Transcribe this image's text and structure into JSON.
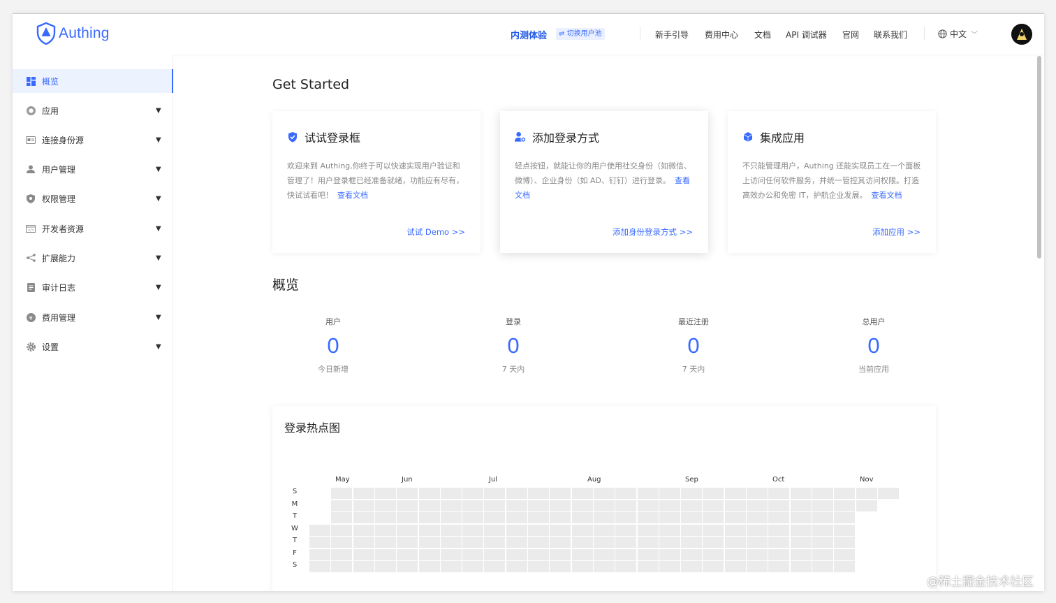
{
  "header": {
    "logo_text": "Authing",
    "beta_label": "内测体验",
    "switch_pool_label": "⇌ 切换用户池",
    "nav": [
      "新手引导",
      "费用中心",
      "文档",
      "API 调试器",
      "官网",
      "联系我们"
    ],
    "language": "中文"
  },
  "sidebar": {
    "items": [
      {
        "label": "概览",
        "icon": "dashboard-icon",
        "active": true
      },
      {
        "label": "应用",
        "icon": "cube-icon"
      },
      {
        "label": "连接身份源",
        "icon": "id-card-icon"
      },
      {
        "label": "用户管理",
        "icon": "user-icon"
      },
      {
        "label": "权限管理",
        "icon": "shield-icon"
      },
      {
        "label": "开发者资源",
        "icon": "code-icon"
      },
      {
        "label": "扩展能力",
        "icon": "share-icon"
      },
      {
        "label": "审计日志",
        "icon": "document-icon"
      },
      {
        "label": "费用管理",
        "icon": "coin-icon"
      },
      {
        "label": "设置",
        "icon": "gear-icon"
      }
    ]
  },
  "get_started": {
    "title": "Get Started",
    "cards": [
      {
        "title": "试试登录框",
        "icon": "shield-check-icon",
        "desc": "欢迎来到 Authing,你终于可以快速实现用户验证和管理了！用户登录框已经准备就绪，功能应有尽有，快试试看吧！",
        "doc_link": "查看文档",
        "action": "试试 Demo >>"
      },
      {
        "title": "添加登录方式",
        "icon": "user-add-icon",
        "desc": "轻点按钮，就能让你的用户使用社交身份（如微信、微博）、企业身份（如 AD、钉钉）进行登录。",
        "doc_link": "查看文档",
        "action": "添加身份登录方式 >>"
      },
      {
        "title": "集成应用",
        "icon": "cube-icon",
        "desc": "不只能管理用户，Authing 还能实现员工在一个面板上访问任何软件服务，并统一管控其访问权限。打造高效办公和免密 IT，护航企业发展。",
        "doc_link": "查看文档",
        "action": "添加应用 >>"
      }
    ]
  },
  "overview": {
    "title": "概览",
    "stats": [
      {
        "title": "用户",
        "value": "0",
        "sub": "今日新增"
      },
      {
        "title": "登录",
        "value": "0",
        "sub": "7 天内"
      },
      {
        "title": "最近注册",
        "value": "0",
        "sub": "7 天内"
      },
      {
        "title": "总用户",
        "value": "0",
        "sub": "当前应用"
      }
    ]
  },
  "heatmap": {
    "title": "登录热点图",
    "months": [
      "May",
      "Jun",
      "Jul",
      "Aug",
      "Sep",
      "Oct",
      "Nov"
    ],
    "days": [
      "S",
      "M",
      "T",
      "W",
      "T",
      "F",
      "S"
    ],
    "empty_color": "#ebebeb"
  },
  "colors": {
    "accent": "#396aff"
  },
  "watermark": "@稀土掘金技术社区"
}
